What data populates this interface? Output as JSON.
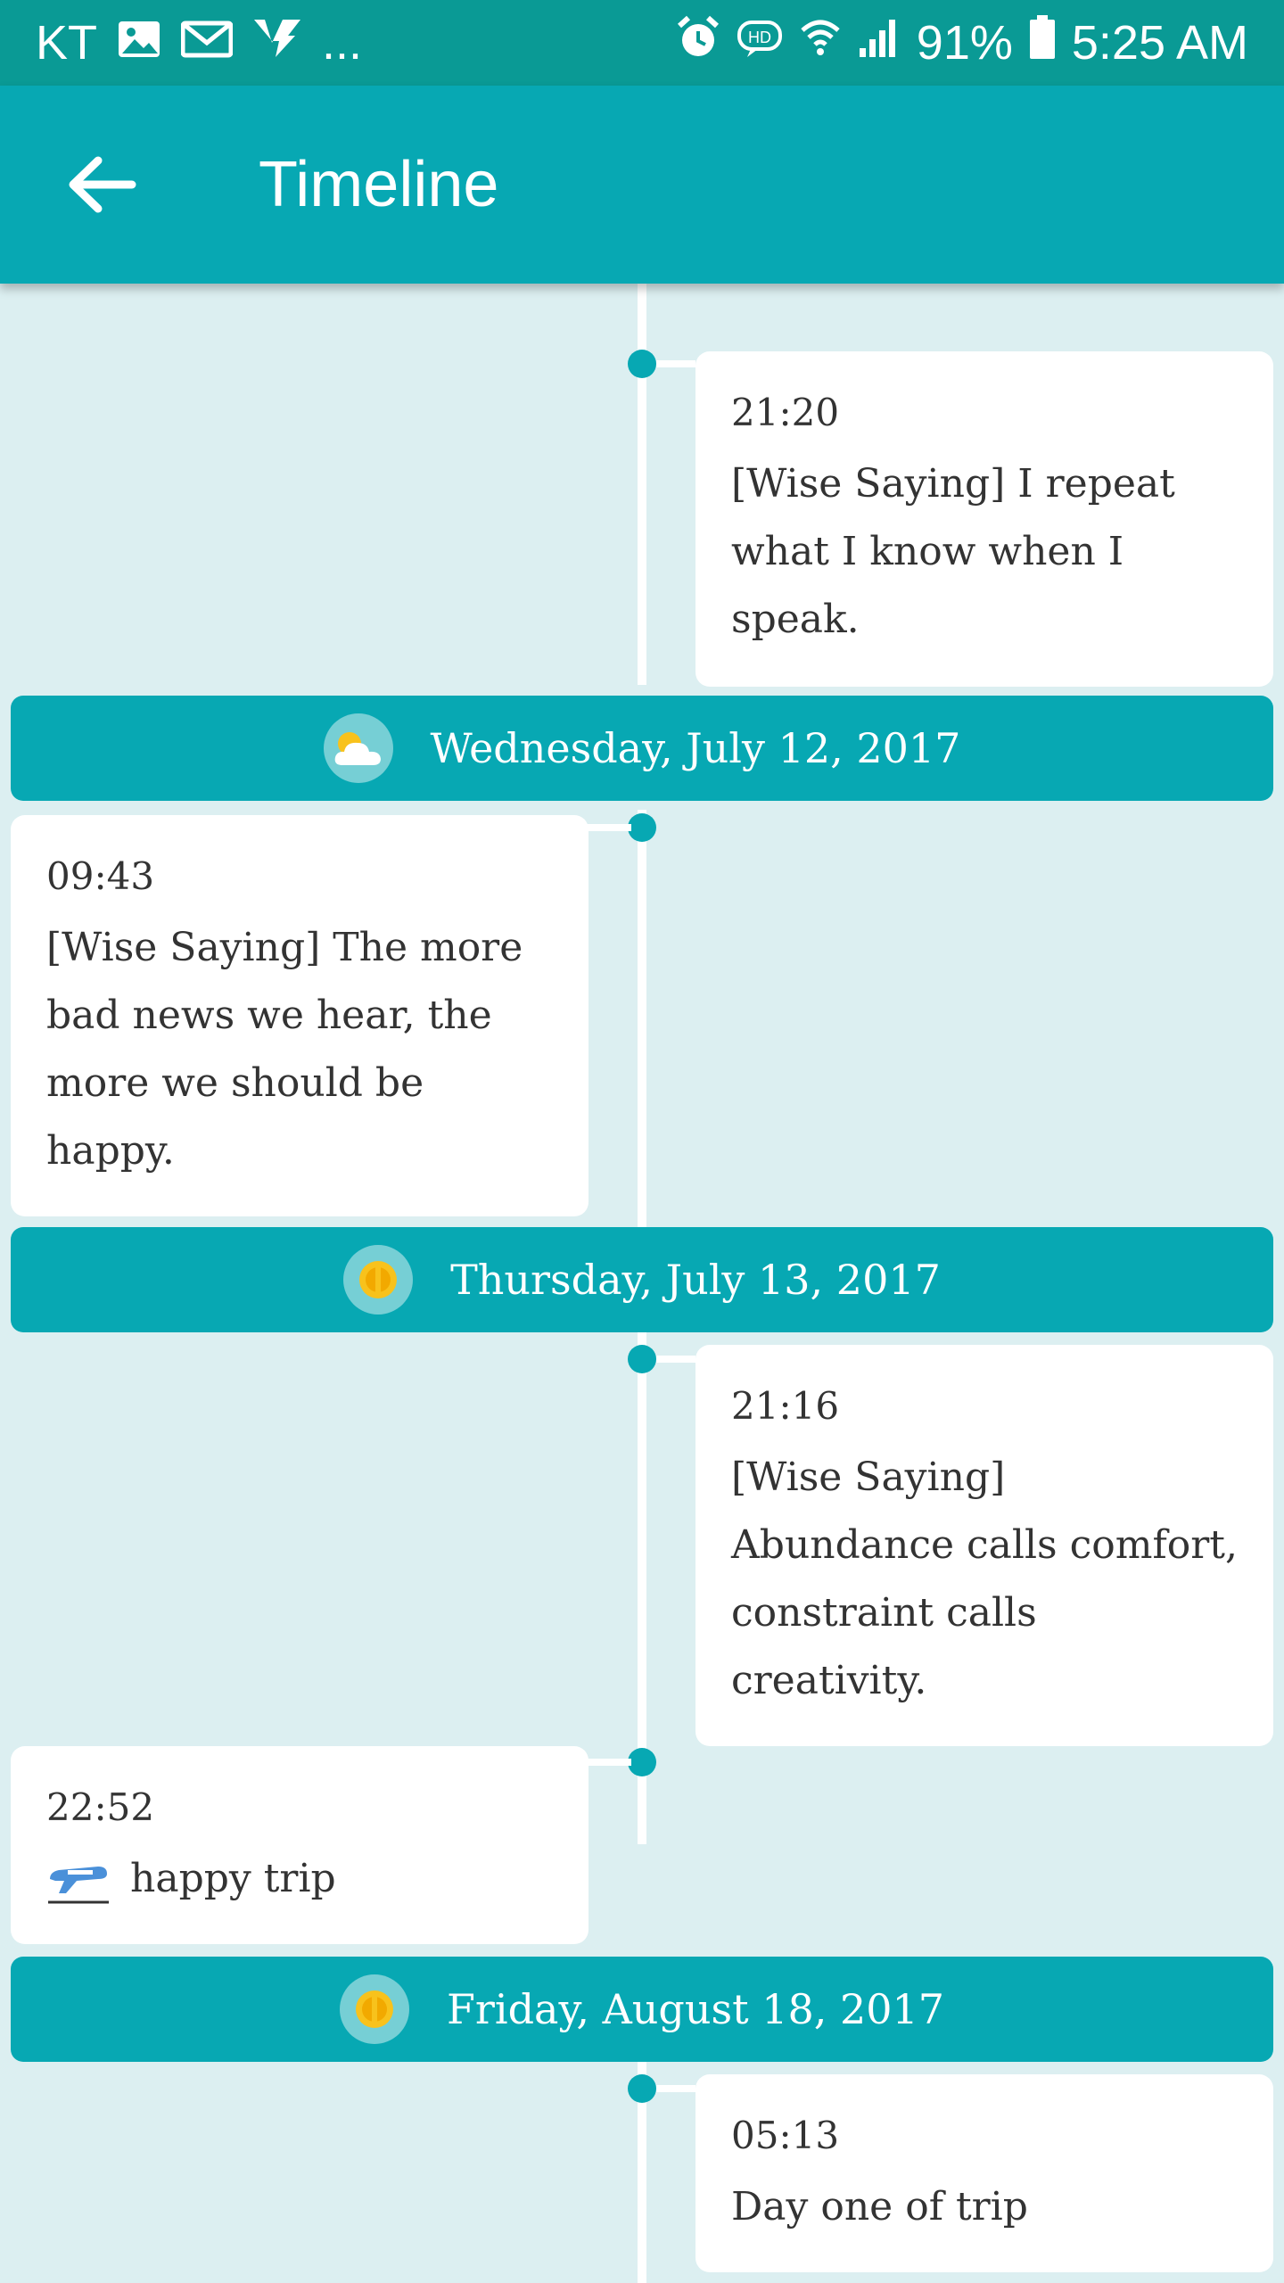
{
  "status_bar": {
    "carrier": "KT",
    "more": "...",
    "hd": "HD",
    "battery": "91%",
    "time": "5:25 AM"
  },
  "app_bar": {
    "title": "Timeline"
  },
  "entries": [
    {
      "time": "21:20",
      "text": "[Wise Saying] I repeat what I know when I speak."
    },
    {
      "time": "09:43",
      "text": "[Wise Saying] The more bad news we hear, the more we should be happy."
    },
    {
      "time": "21:16",
      "text": "[Wise Saying] Abundance calls comfort, constraint calls creativity."
    },
    {
      "time": "22:52",
      "text": "happy trip"
    },
    {
      "time": "05:13",
      "text": "Day one of trip"
    }
  ],
  "dates": [
    {
      "label": "Wednesday, July 12, 2017",
      "weather": "partly-cloudy-icon"
    },
    {
      "label": "Thursday, July 13, 2017",
      "weather": "sun-icon"
    },
    {
      "label": "Friday, August 18, 2017",
      "weather": "sun-icon"
    }
  ],
  "colors": {
    "accent": "#07a8b3",
    "status": "#0a9a95",
    "background": "#dceff1"
  }
}
